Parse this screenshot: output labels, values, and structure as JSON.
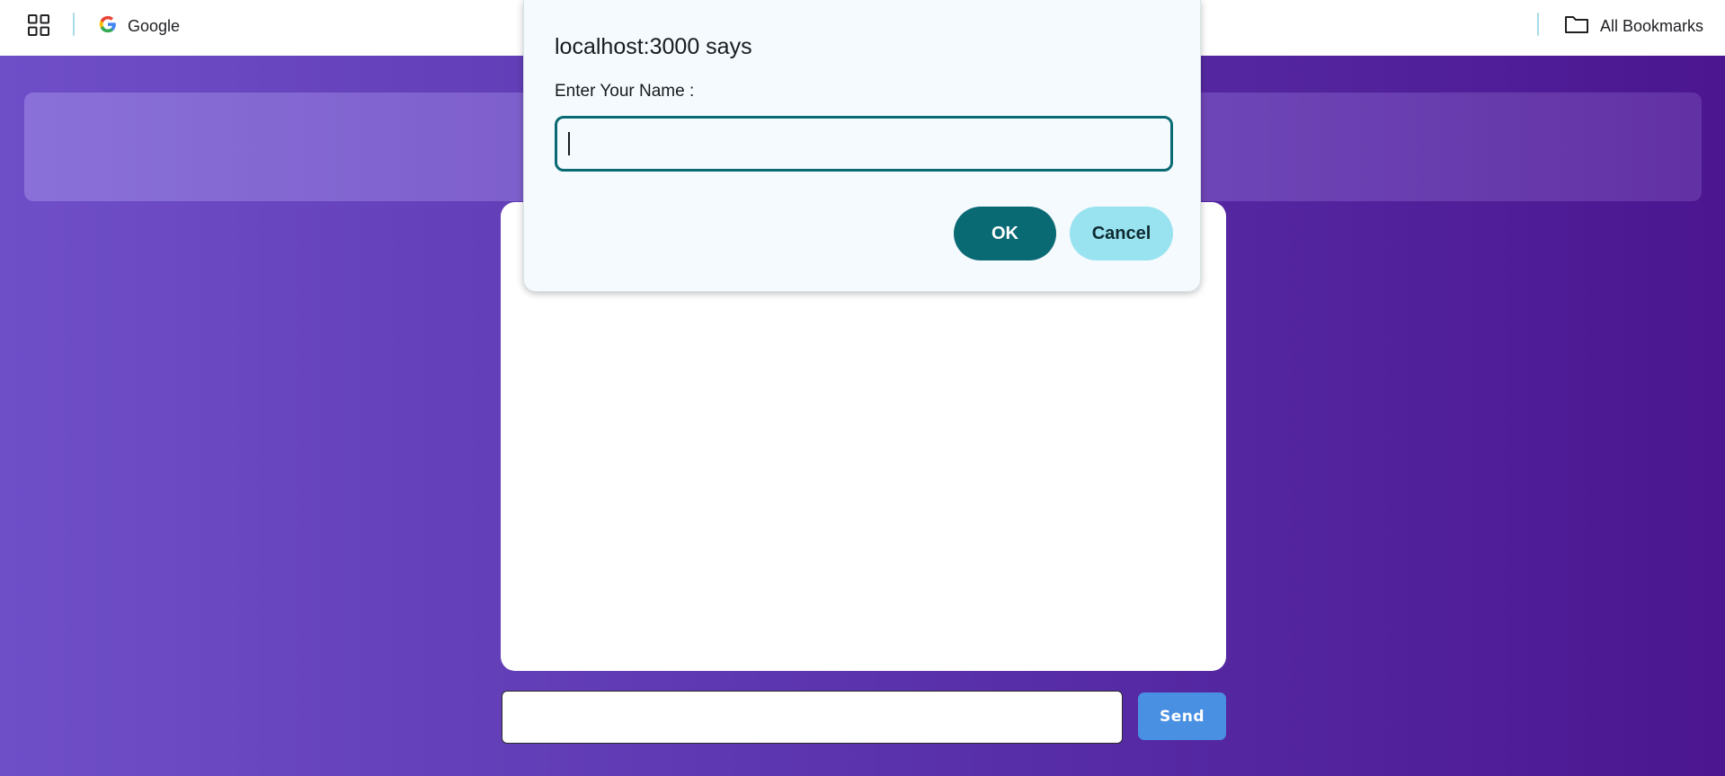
{
  "bookmarks_bar": {
    "apps_icon": "apps-grid-icon",
    "google_label": "Google",
    "all_bookmarks_label": "All Bookmarks"
  },
  "chat": {
    "message_input_value": "",
    "send_label": "Send",
    "accent_color": "#4a90e2"
  },
  "dialog": {
    "title": "localhost:3000 says",
    "message": "Enter Your Name :",
    "input_value": "",
    "ok_label": "OK",
    "cancel_label": "Cancel",
    "primary_color": "#0a6a74",
    "secondary_color": "#98e3ef"
  }
}
